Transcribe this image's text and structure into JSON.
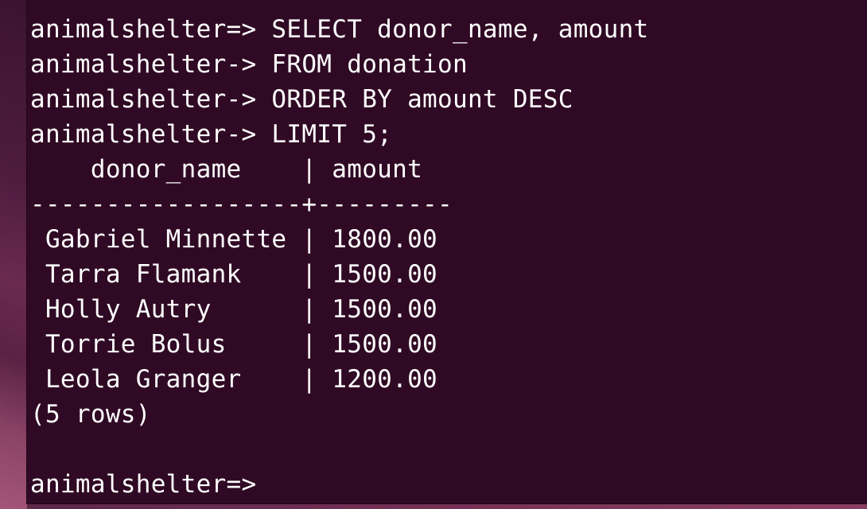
{
  "terminal": {
    "lines": [
      "animalshelter=> SELECT donor_name, amount",
      "animalshelter-> FROM donation",
      "animalshelter-> ORDER BY amount DESC",
      "animalshelter-> LIMIT 5;",
      "    donor_name    | amount",
      "------------------+---------",
      " Gabriel Minnette | 1800.00",
      " Tarra Flamank    | 1500.00",
      " Holly Autry      | 1500.00",
      " Torrie Bolus     | 1500.00",
      " Leola Granger    | 1200.00",
      "(5 rows)",
      "",
      "animalshelter=>"
    ]
  },
  "colors": {
    "terminal_background": "#300a24",
    "text": "#ffffff"
  }
}
